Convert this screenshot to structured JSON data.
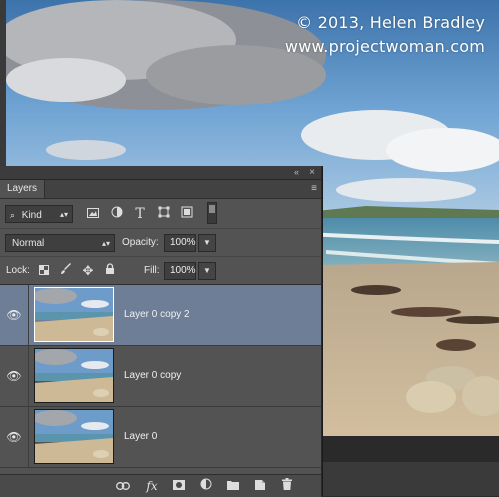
{
  "watermark": {
    "line1": "© 2013, Helen Bradley",
    "line2": "www.projectwoman.com"
  },
  "panel": {
    "collapse_icon": "«",
    "close_icon": "×",
    "tab_label": "Layers",
    "tab_menu_icon": "≡"
  },
  "filter": {
    "kind_label": "Kind",
    "icons": [
      "image-filter-icon",
      "adjustment-filter-icon",
      "type-filter-icon",
      "shape-filter-icon",
      "smart-object-filter-icon"
    ]
  },
  "blend": {
    "mode": "Normal",
    "opacity_label": "Opacity:",
    "opacity_value": "100%",
    "lock_label": "Lock:",
    "fill_label": "Fill:",
    "fill_value": "100%"
  },
  "layers": [
    {
      "name": "Layer 0 copy 2",
      "selected": true,
      "visible": true
    },
    {
      "name": "Layer 0 copy",
      "selected": false,
      "visible": true
    },
    {
      "name": "Layer 0",
      "selected": false,
      "visible": true
    }
  ],
  "footer_icons": [
    "link-layers-icon",
    "fx-icon",
    "add-mask-icon",
    "adjustment-layer-icon",
    "group-folder-icon",
    "new-layer-icon",
    "trash-icon"
  ],
  "colors": {
    "panel_bg": "#535353",
    "selected_row": "#6d7e96",
    "sky_blue": "#6c9fd2",
    "sand": "#c9b28f"
  }
}
